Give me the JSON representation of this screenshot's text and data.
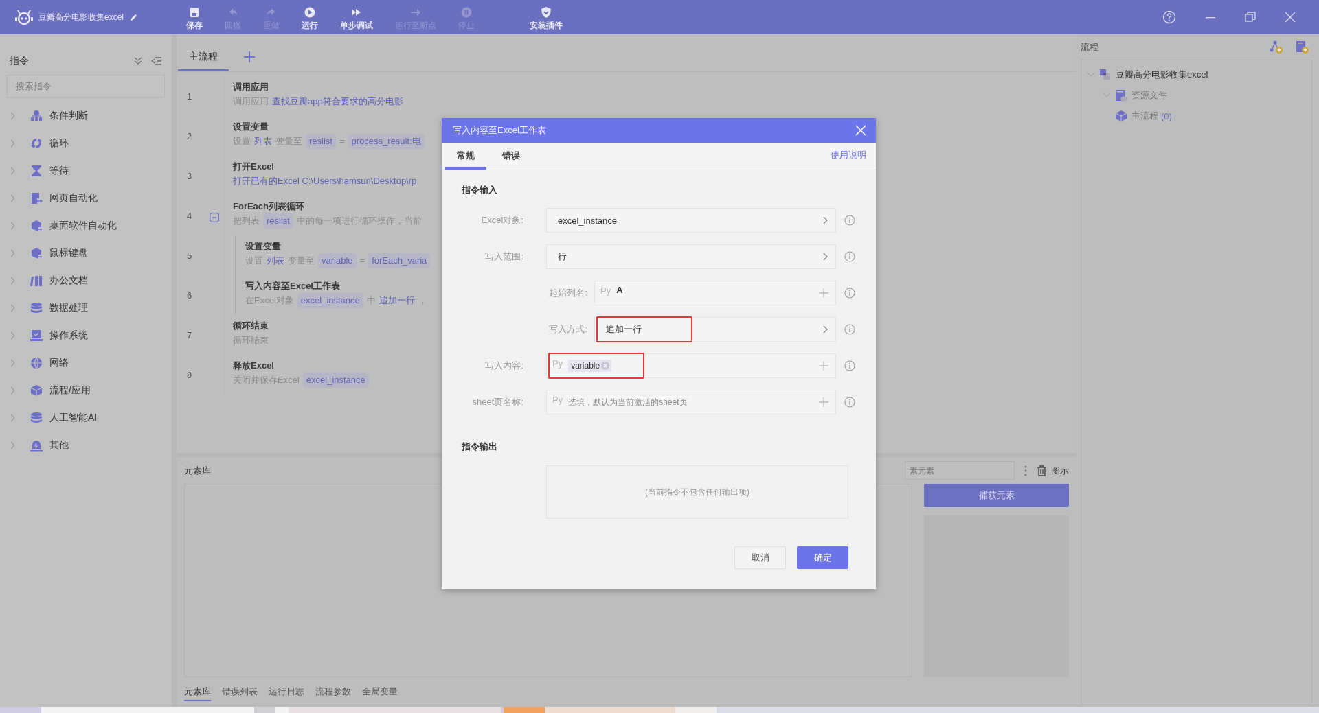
{
  "app": {
    "title": "豆瓣高分电影收集excel"
  },
  "toolbar": [
    {
      "label": "保存",
      "disabled": false
    },
    {
      "label": "回撤",
      "disabled": true
    },
    {
      "label": "重做",
      "disabled": true
    },
    {
      "label": "运行",
      "disabled": false
    },
    {
      "label": "单步调试",
      "disabled": false
    },
    {
      "label": "运行至断点",
      "disabled": true
    },
    {
      "label": "停止",
      "disabled": true
    },
    {
      "label": "安装插件",
      "disabled": false
    }
  ],
  "sidebar": {
    "title": "指令",
    "search_placeholder": "搜索指令",
    "items": [
      {
        "label": "条件判断",
        "expanded": false
      },
      {
        "label": "循环",
        "expanded": false
      },
      {
        "label": "等待",
        "expanded": false
      },
      {
        "label": "网页自动化",
        "expanded": false
      },
      {
        "label": "桌面软件自动化",
        "expanded": false
      },
      {
        "label": "鼠标键盘",
        "expanded": false
      },
      {
        "label": "办公文档",
        "expanded": false
      },
      {
        "label": "数据处理",
        "expanded": false
      },
      {
        "label": "操作系统",
        "expanded": false
      },
      {
        "label": "网络",
        "expanded": false
      },
      {
        "label": "流程/应用",
        "expanded": false
      },
      {
        "label": "人工智能AI",
        "expanded": false
      },
      {
        "label": "其他",
        "expanded": false
      }
    ]
  },
  "flow": {
    "tabs": [
      {
        "label": "主流程",
        "selected": true
      }
    ],
    "steps": [
      {
        "number": "1",
        "title": "调用应用",
        "indented": false,
        "collapsible": false,
        "description": [
          {
            "kind": "text",
            "text": "调用应用"
          },
          {
            "kind": "link",
            "text": "查找豆瓣app符合要求的高分电影"
          }
        ]
      },
      {
        "number": "2",
        "title": "设置变量",
        "indented": false,
        "collapsible": false,
        "description": [
          {
            "kind": "text",
            "text": "设置"
          },
          {
            "kind": "link",
            "text": "列表"
          },
          {
            "kind": "text",
            "text": "变量至"
          },
          {
            "kind": "chip",
            "text": "reslist"
          },
          {
            "kind": "text",
            "text": "="
          },
          {
            "kind": "chip",
            "text": "process_result:电"
          }
        ]
      },
      {
        "number": "3",
        "title": "打开Excel",
        "indented": false,
        "collapsible": false,
        "description": [
          {
            "kind": "link",
            "text": "打开已有的Excel C:\\Users\\hamsun\\Desktop\\rp"
          }
        ]
      },
      {
        "number": "4",
        "title": "ForEach列表循环",
        "indented": false,
        "collapsible": true,
        "description": [
          {
            "kind": "text",
            "text": "把列表"
          },
          {
            "kind": "chip",
            "text": "reslist"
          },
          {
            "kind": "text",
            "text": "中的每一项进行循环操作，当前"
          }
        ]
      },
      {
        "number": "5",
        "title": "设置变量",
        "indented": true,
        "collapsible": false,
        "description": [
          {
            "kind": "text",
            "text": "设置"
          },
          {
            "kind": "link",
            "text": "列表"
          },
          {
            "kind": "text",
            "text": "变量至"
          },
          {
            "kind": "chip",
            "text": "variable"
          },
          {
            "kind": "text",
            "text": "="
          },
          {
            "kind": "chip",
            "text": "forEach_varia"
          }
        ]
      },
      {
        "number": "6",
        "title": "写入内容至Excel工作表",
        "indented": true,
        "collapsible": false,
        "description": [
          {
            "kind": "text",
            "text": "在Excel对象"
          },
          {
            "kind": "chip",
            "text": "excel_instance"
          },
          {
            "kind": "text",
            "text": "中"
          },
          {
            "kind": "link",
            "text": "追加一行"
          },
          {
            "kind": "text",
            "text": "，"
          }
        ]
      },
      {
        "number": "7",
        "title": "循环结束",
        "indented": false,
        "collapsible": false,
        "description": [
          {
            "kind": "text",
            "text": "循环结束"
          }
        ]
      },
      {
        "number": "8",
        "title": "释放Excel",
        "indented": false,
        "collapsible": false,
        "description": [
          {
            "kind": "text",
            "text": "关闭并保存Excel"
          },
          {
            "kind": "chip",
            "text": "excel_instance"
          }
        ]
      }
    ]
  },
  "element_library": {
    "title": "元素库",
    "search_placeholder": "素元素",
    "legend_label": "图示",
    "capture_button": "捕获元素"
  },
  "bottom_tabs": [
    {
      "label": "元素库",
      "selected": true
    },
    {
      "label": "错误列表",
      "selected": false
    },
    {
      "label": "运行日志",
      "selected": false
    },
    {
      "label": "流程参数",
      "selected": false
    },
    {
      "label": "全局变量",
      "selected": false
    }
  ],
  "process_panel": {
    "title": "流程",
    "tree": [
      {
        "kind": "project",
        "label": "豆瓣高分电影收集excel",
        "expanded": true,
        "children": [
          {
            "kind": "folder",
            "label": "资源文件",
            "expanded": true
          },
          {
            "kind": "flow",
            "label": "主流程",
            "count": "(0)"
          }
        ]
      }
    ]
  },
  "dialog": {
    "title": "写入内容至Excel工作表",
    "tabs": [
      {
        "label": "常规",
        "selected": true
      },
      {
        "label": "错误",
        "selected": false
      }
    ],
    "help_link": "使用说明",
    "input_section": "指令输入",
    "fields": [
      {
        "label": "Excel对象:",
        "kind": "select",
        "value": "excel_instance",
        "indented": false,
        "highlighted": false
      },
      {
        "label": "写入范围:",
        "kind": "select",
        "value": "行",
        "indented": false,
        "highlighted": false
      },
      {
        "label": "起始列名:",
        "kind": "expression",
        "prefix": "Py",
        "value": "A",
        "indented": true,
        "highlighted": false
      },
      {
        "label": "写入方式:",
        "kind": "select",
        "value": "追加一行",
        "indented": true,
        "highlighted": true
      },
      {
        "label": "写入内容:",
        "kind": "expression",
        "prefix": "Py",
        "token": "variable",
        "indented": false,
        "highlighted": true
      },
      {
        "label": "sheet页名称:",
        "kind": "expression",
        "prefix": "Py",
        "placeholder": "选填，默认为当前激活的sheet页",
        "indented": false,
        "highlighted": false
      }
    ],
    "output_section": "指令输出",
    "output_empty": "(当前指令不包含任何输出项)",
    "buttons": [
      {
        "label": "取消",
        "kind": "secondary"
      },
      {
        "label": "确定",
        "kind": "primary"
      }
    ]
  }
}
